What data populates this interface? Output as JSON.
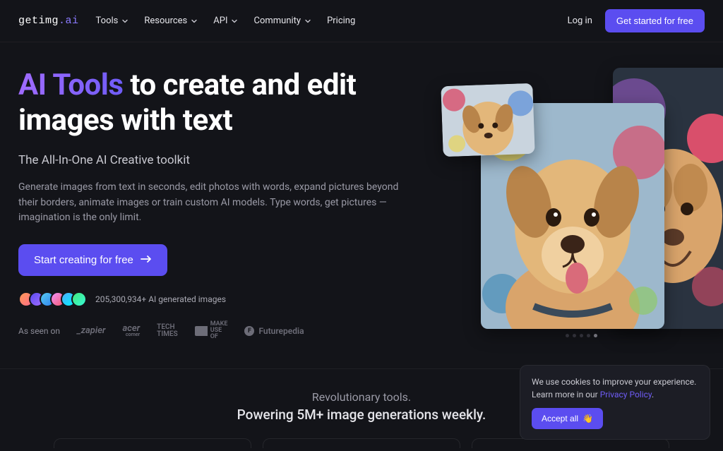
{
  "brand": {
    "prefix": "getimg",
    "dot": ".",
    "suffix": "ai"
  },
  "nav": {
    "items": [
      {
        "label": "Tools"
      },
      {
        "label": "Resources"
      },
      {
        "label": "API"
      },
      {
        "label": "Community"
      },
      {
        "label": "Pricing"
      }
    ],
    "login": "Log in",
    "cta": "Get started for free"
  },
  "hero": {
    "title_grad": "AI Tools",
    "title_rest": " to create and edit images with text",
    "subtitle": "The All-In-One AI Creative toolkit",
    "description": "Generate images from text in seconds, edit photos with words, expand pictures beyond their borders, animate images or train custom AI models. Type words, get pictures — imagination is the only limit.",
    "cta": "Start creating for free",
    "stats": "205,300,934+ AI generated images",
    "seen_label": "As seen on",
    "seen": {
      "zapier": "_zapier",
      "acer": "acer",
      "acer_sub": "corner",
      "tech1": "TECH",
      "tech2": "TIMES",
      "make1": "MAKE",
      "make2": "USE",
      "make3": "OF",
      "fut": "Futurepedia",
      "fut_f": "F"
    }
  },
  "section2": {
    "line1": "Revolutionary tools.",
    "line2": "Powering 5M+ image generations weekly."
  },
  "cookie": {
    "text1": "We use cookies to improve your experience. Learn more in our ",
    "link": "Privacy Policy",
    "text2": ".",
    "btn": "Accept all",
    "emoji": "👋"
  }
}
